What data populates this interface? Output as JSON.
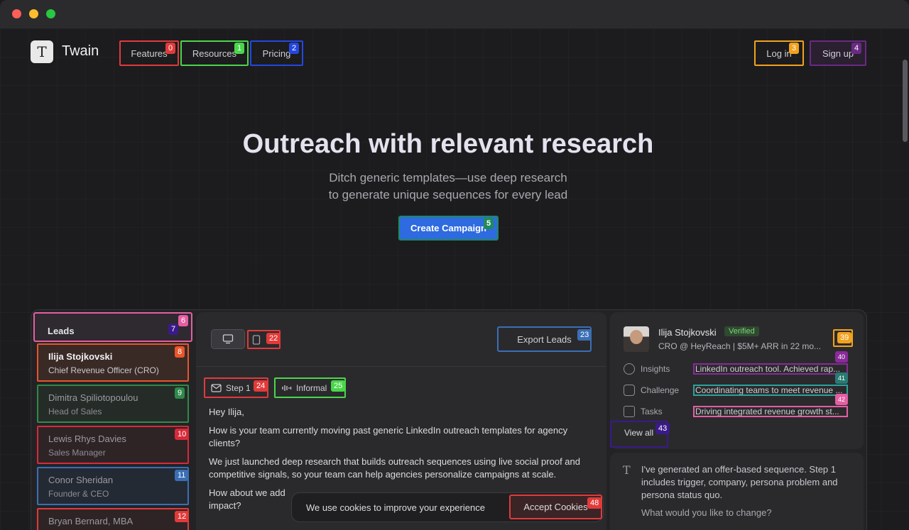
{
  "brand": {
    "logo_letter": "T",
    "name": "Twain"
  },
  "nav": {
    "features": "Features",
    "features_tag": "0",
    "resources": "Resources",
    "resources_tag": "1",
    "pricing": "Pricing",
    "pricing_tag": "2",
    "login": "Log in",
    "login_tag": "3",
    "signup": "Sign up",
    "signup_tag": "4"
  },
  "hero": {
    "title": "Outreach with relevant research",
    "subtitle_line1": "Ditch generic templates—use deep research",
    "subtitle_line2": "to generate unique sequences for every lead",
    "cta": "Create Campaign",
    "cta_tag": "5"
  },
  "leads": {
    "header": "Leads",
    "header_tag": "6",
    "header_tag2": "7",
    "items": [
      {
        "name": "Ilija Stojkovski",
        "role": "Chief Revenue Officer (CRO)",
        "tag": "8"
      },
      {
        "name": "Dimitra Spiliotopoulou",
        "role": "Head of Sales",
        "tag": "9"
      },
      {
        "name": "Lewis Rhys Davies",
        "role": "Sales Manager",
        "tag": "10"
      },
      {
        "name": "Conor Sheridan",
        "role": "Founder & CEO",
        "tag": "11"
      },
      {
        "name": "Bryan Bernard, MBA",
        "role": "",
        "tag": "12"
      }
    ]
  },
  "toolbar": {
    "view2_tag": "22",
    "export": "Export Leads",
    "export_tag": "23"
  },
  "steps": {
    "step": "Step 1",
    "step_tag": "24",
    "tone": "Informal",
    "tone_tag": "25"
  },
  "email": {
    "greeting": "Hey Ilija,",
    "p1": "How is your team currently moving past generic LinkedIn outreach templates for agency clients?",
    "p2": "We just launched deep research that builds outreach sequences using live social proof and competitive signals, so your team can help agencies personalize campaigns at scale.",
    "p3": "How about we add",
    "p3b": "impact?"
  },
  "profile": {
    "name": "Ilija Stojkovski",
    "verified": "Verified",
    "subtitle": "CRO @ HeyReach | $5M+ ARR in 22 mo...",
    "expand_tag": "39",
    "rows": [
      {
        "label": "Insights",
        "value": "LinkedIn outreach tool. Achieved rap...",
        "tag": "40",
        "border": "#8a2a9a"
      },
      {
        "label": "Challenge",
        "value": "Coordinating teams to meet revenue ...",
        "tag": "41",
        "border": "#2aa39a"
      },
      {
        "label": "Tasks",
        "value": "Driving integrated revenue growth st...",
        "tag": "42",
        "border": "#e55ea3"
      }
    ],
    "view_all": "View all",
    "view_all_tag": "43"
  },
  "assistant": {
    "message": "I've generated an offer-based sequence. Step 1 includes trigger, company, persona problem and persona status quo.",
    "question": "What would you like to change?"
  },
  "cookie": {
    "text": "We use cookies to improve your experience",
    "button": "Accept Cookies",
    "button_tag": "48"
  }
}
